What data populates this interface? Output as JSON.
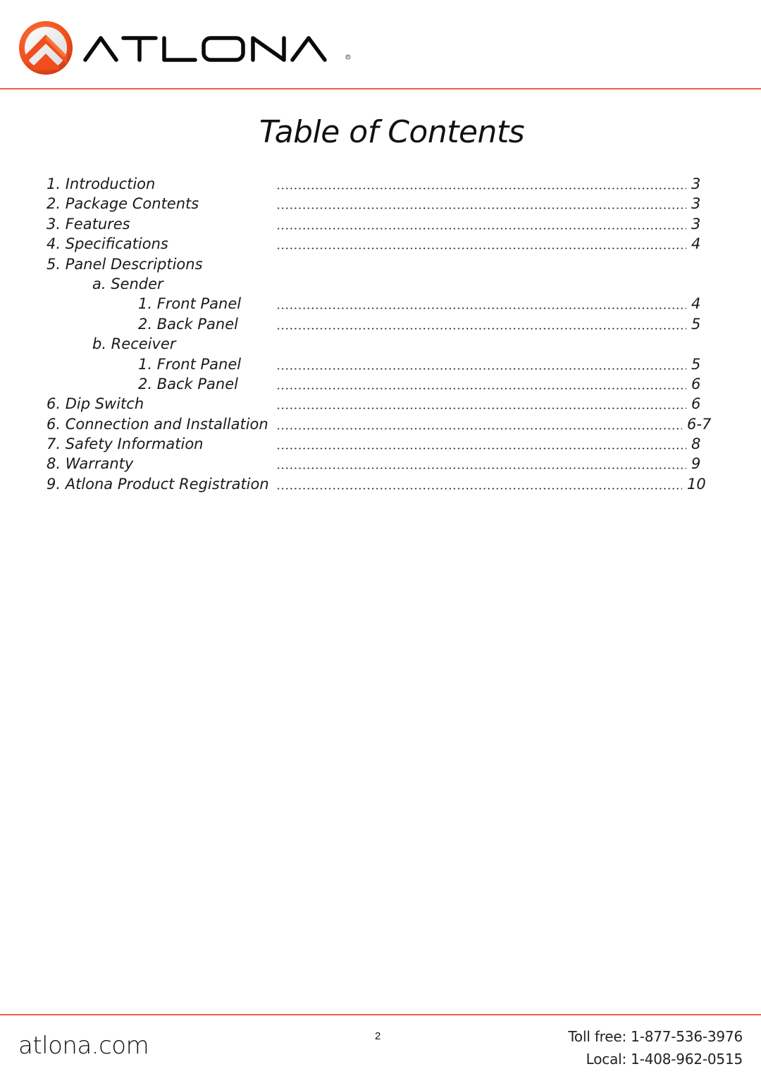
{
  "header": {
    "brand_name": "ATLONA",
    "logo_icon": "atlona-chevron-logo-icon",
    "registered_mark": "®",
    "accent_color": "#f15a4a",
    "logo_orange": "#f04e1e"
  },
  "title": "Table of Contents",
  "toc": [
    {
      "level": 0,
      "label": "1. Introduction",
      "page": "3"
    },
    {
      "level": 0,
      "label": "2. Package Contents",
      "page": "3"
    },
    {
      "level": 0,
      "label": "3. Features",
      "page": "3"
    },
    {
      "level": 0,
      "label": "4. Specifications",
      "page": "4"
    },
    {
      "level": 0,
      "label": "5. Panel Descriptions",
      "page": ""
    },
    {
      "level": 1,
      "label": "a. Sender",
      "page": ""
    },
    {
      "level": 2,
      "label": "1. Front Panel",
      "page": "4"
    },
    {
      "level": 2,
      "label": "2. Back Panel",
      "page": "5"
    },
    {
      "level": 1,
      "label": "b. Receiver",
      "page": ""
    },
    {
      "level": 2,
      "label": "1. Front Panel",
      "page": "5"
    },
    {
      "level": 2,
      "label": "2. Back Panel",
      "page": "6"
    },
    {
      "level": 0,
      "label": "6. Dip Switch",
      "page": "6"
    },
    {
      "level": 0,
      "label": "6. Connection and Installation",
      "page": "6-7"
    },
    {
      "level": 0,
      "label": "7. Safety Information",
      "page": "8"
    },
    {
      "level": 0,
      "label": "8. Warranty",
      "page": "9"
    },
    {
      "level": 0,
      "label": "9. Atlona Product Registration",
      "page": "10"
    }
  ],
  "footer": {
    "website": "atlona.com",
    "page_number": "2",
    "toll_free": "Toll free: 1-877-536-3976",
    "local": "Local: 1-408-962-0515"
  }
}
